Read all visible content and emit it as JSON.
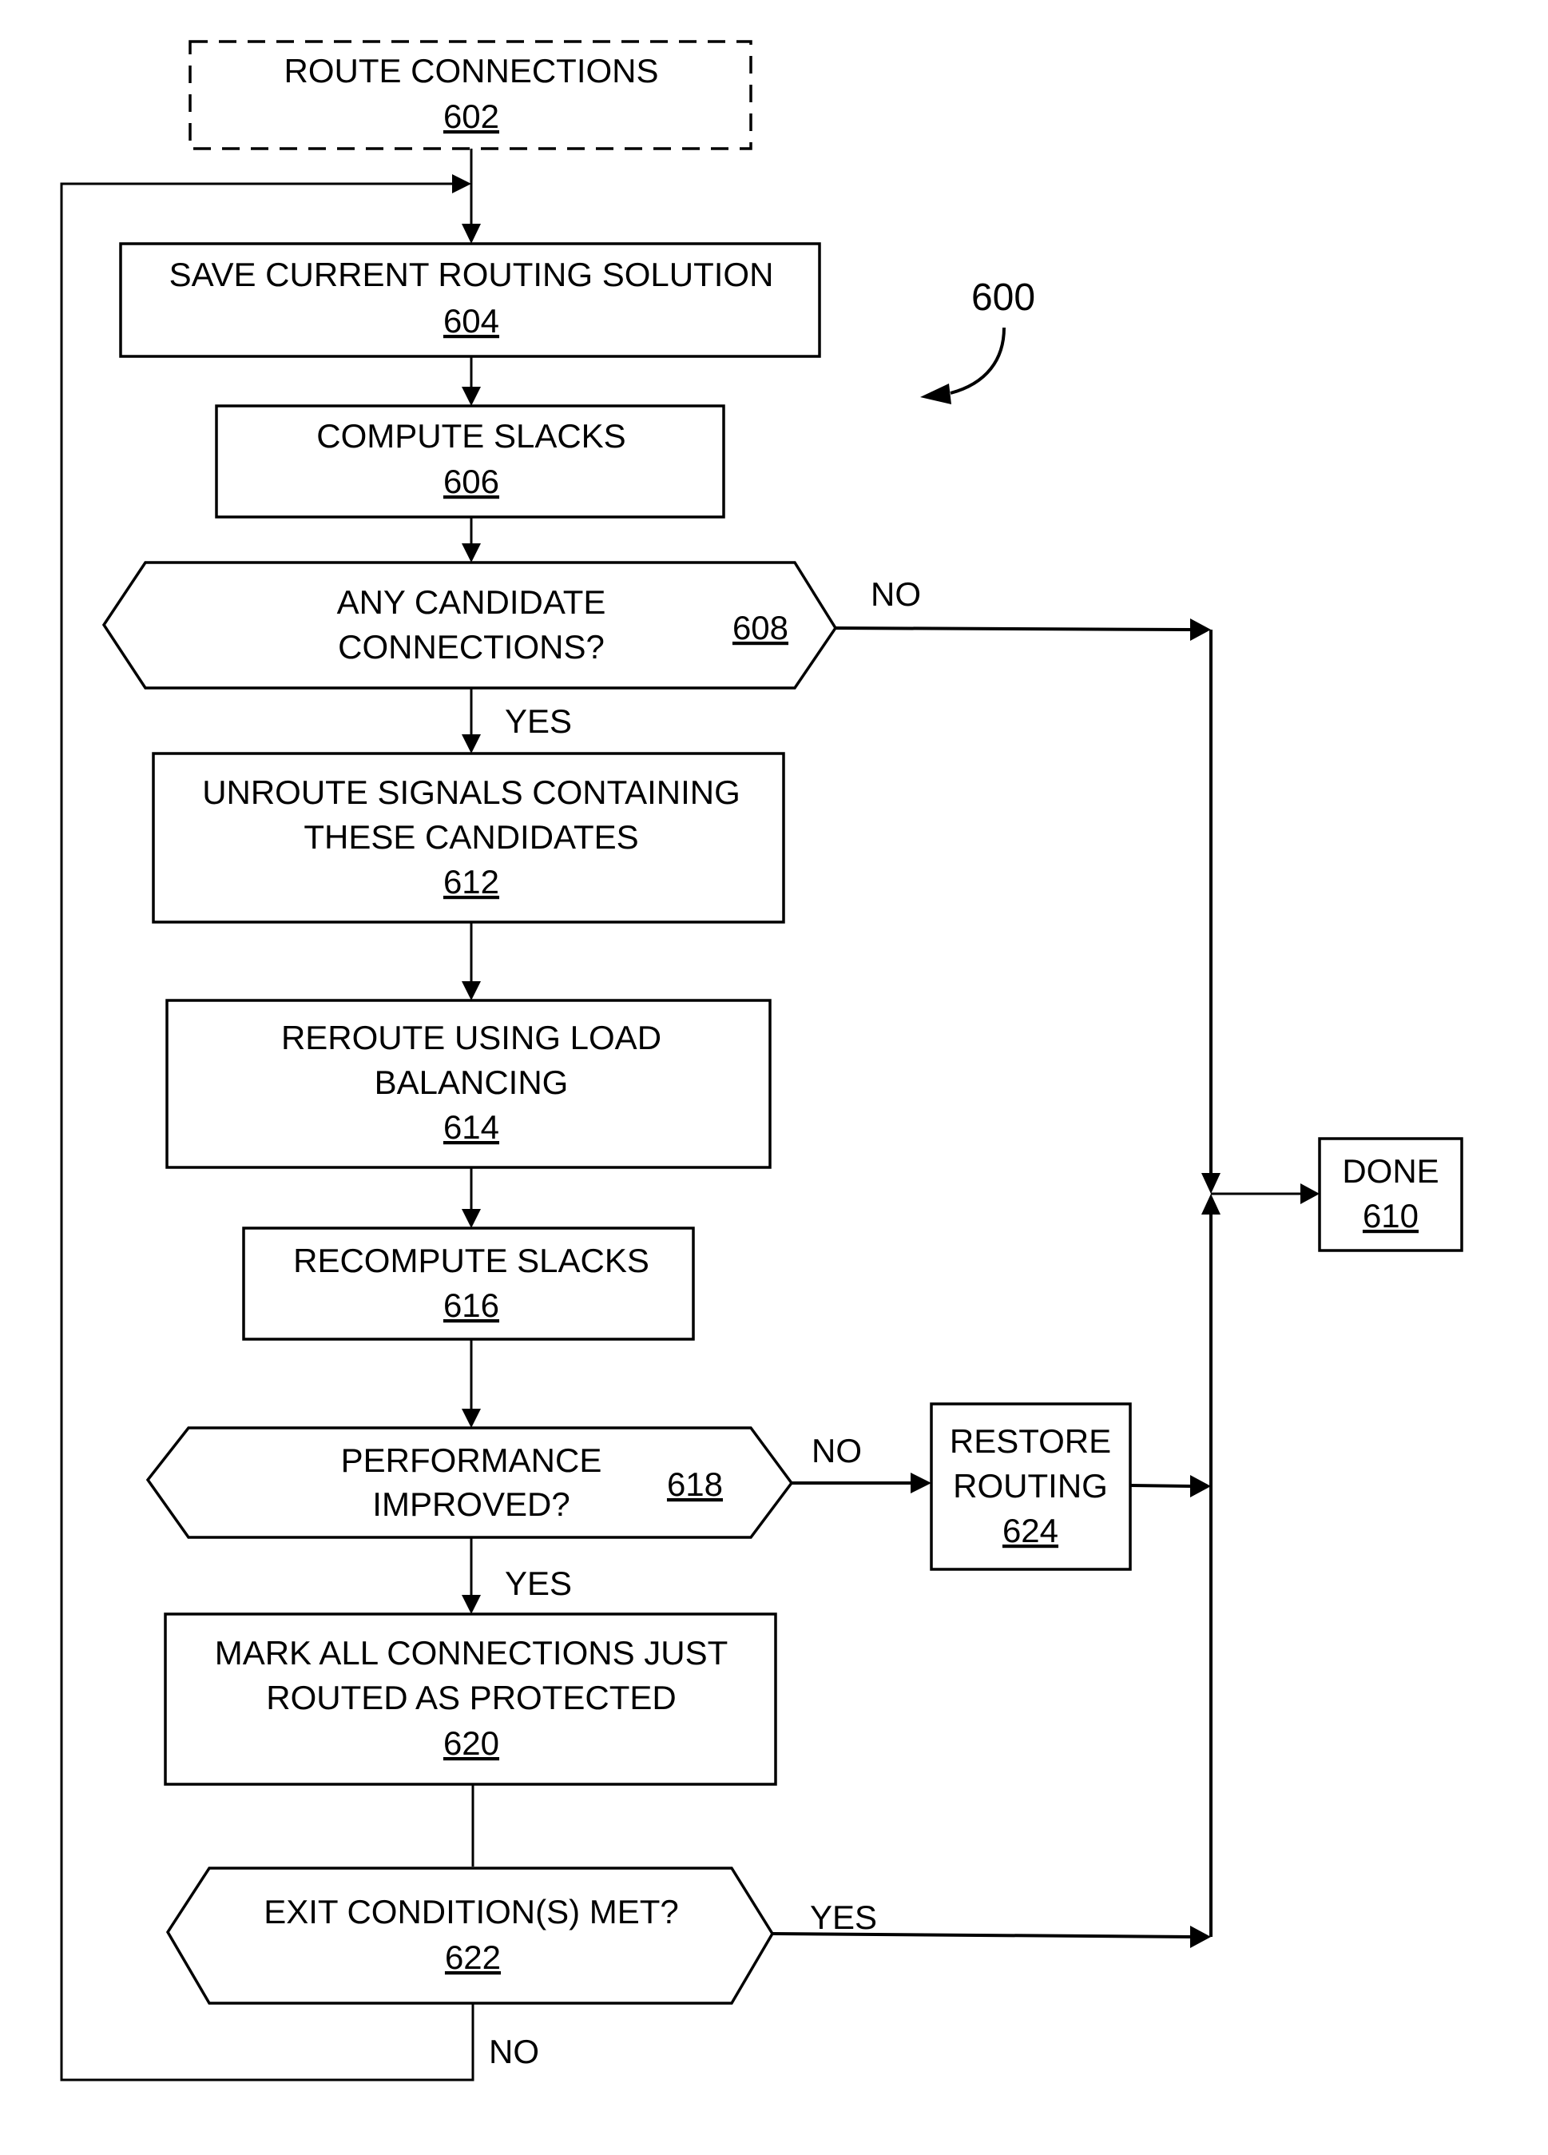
{
  "figure": {
    "reference": "600",
    "start": {
      "lines": [
        "ROUTE CONNECTIONS"
      ],
      "ref": "602"
    },
    "steps": {
      "s604": {
        "lines": [
          "SAVE CURRENT ROUTING SOLUTION"
        ],
        "ref": "604"
      },
      "s606": {
        "lines": [
          "COMPUTE SLACKS"
        ],
        "ref": "606"
      },
      "d608": {
        "lines": [
          "ANY CANDIDATE",
          "CONNECTIONS?"
        ],
        "ref": "608"
      },
      "s612": {
        "lines": [
          "UNROUTE SIGNALS CONTAINING",
          "THESE CANDIDATES"
        ],
        "ref": "612"
      },
      "s614": {
        "lines": [
          "REROUTE USING LOAD",
          "BALANCING"
        ],
        "ref": "614"
      },
      "s616": {
        "lines": [
          "RECOMPUTE SLACKS"
        ],
        "ref": "616"
      },
      "d618": {
        "lines": [
          "PERFORMANCE",
          "IMPROVED?"
        ],
        "ref": "618"
      },
      "s624": {
        "lines": [
          "RESTORE",
          "ROUTING"
        ],
        "ref": "624"
      },
      "s620": {
        "lines": [
          "MARK ALL CONNECTIONS JUST",
          "ROUTED AS PROTECTED"
        ],
        "ref": "620"
      },
      "d622": {
        "lines": [
          "EXIT CONDITION(S) MET?"
        ],
        "ref": "622"
      },
      "s610": {
        "lines": [
          "DONE"
        ],
        "ref": "610"
      }
    },
    "edge_labels": {
      "d608_no": "NO",
      "d608_yes": "YES",
      "d618_no": "NO",
      "d618_yes": "YES",
      "d622_yes": "YES",
      "d622_no": "NO"
    }
  }
}
